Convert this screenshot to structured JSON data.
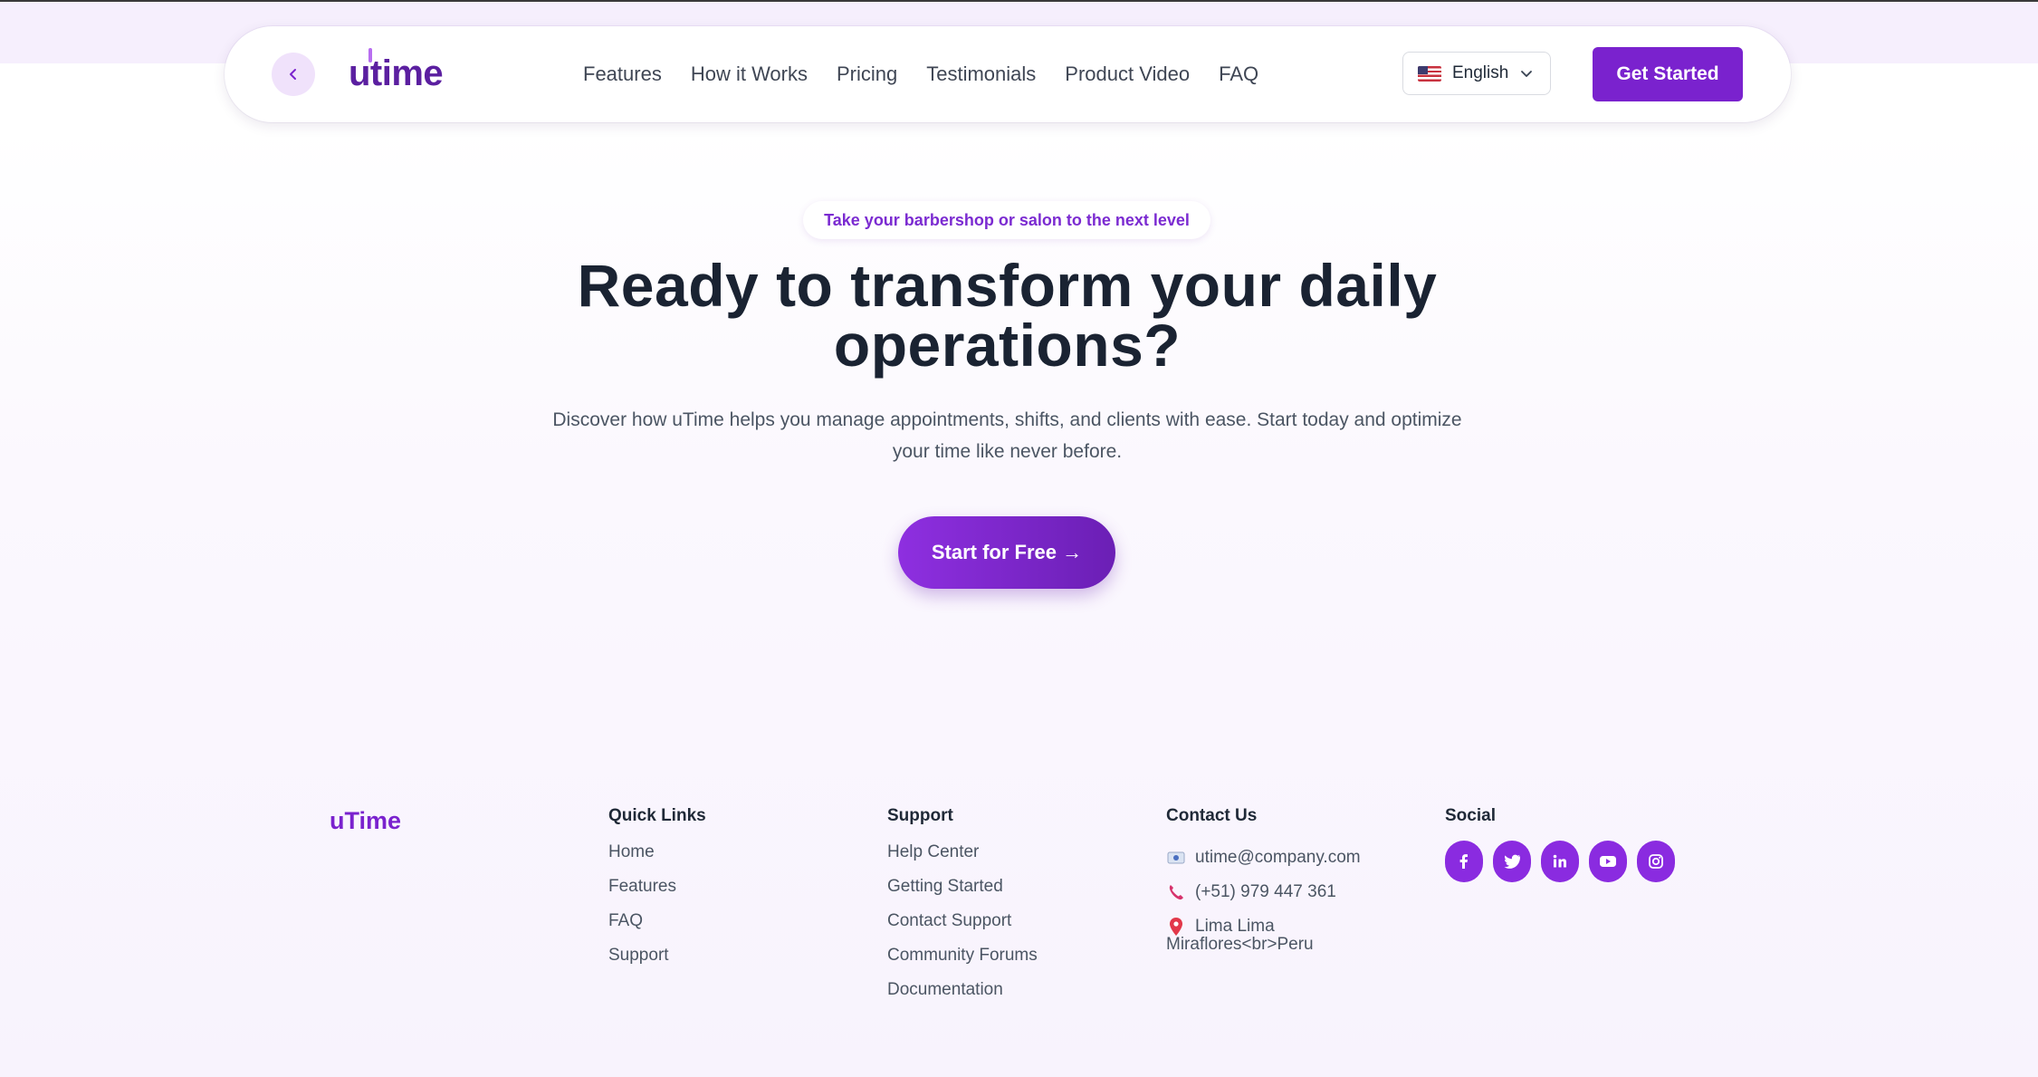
{
  "nav": {
    "logo": "utime",
    "links": [
      "Features",
      "How it Works",
      "Pricing",
      "Testimonials",
      "Product Video",
      "FAQ"
    ],
    "language": "English",
    "cta": "Get Started"
  },
  "hero": {
    "badge": "Take your barbershop or salon to the next level",
    "title_line1": "Ready to transform your daily",
    "title_line2": "operations?",
    "subtitle_line1": "Discover how uTime helps you manage appointments, shifts, and clients with ease. Start today and optimize",
    "subtitle_line2": "your time like never before.",
    "cta": "Start for Free →"
  },
  "footer": {
    "brand": "uTime",
    "quick_links": {
      "title": "Quick Links",
      "items": [
        "Home",
        "Features",
        "FAQ",
        "Support"
      ]
    },
    "support": {
      "title": "Support",
      "items": [
        "Help Center",
        "Getting Started",
        "Contact Support",
        "Community Forums",
        "Documentation"
      ]
    },
    "contact": {
      "title": "Contact Us",
      "email": "utime@company.com",
      "phone": "(+51) 979 447 361",
      "address_line1": "Lima Lima",
      "address_line2": "Miraflores<br>Peru"
    },
    "social": {
      "title": "Social",
      "icons": [
        "facebook-icon",
        "twitter-icon",
        "linkedin-icon",
        "youtube-icon",
        "instagram-icon"
      ]
    }
  },
  "colors": {
    "brand_purple": "#7a22ce",
    "heading": "#1a2332",
    "body_text": "#4b5563"
  }
}
